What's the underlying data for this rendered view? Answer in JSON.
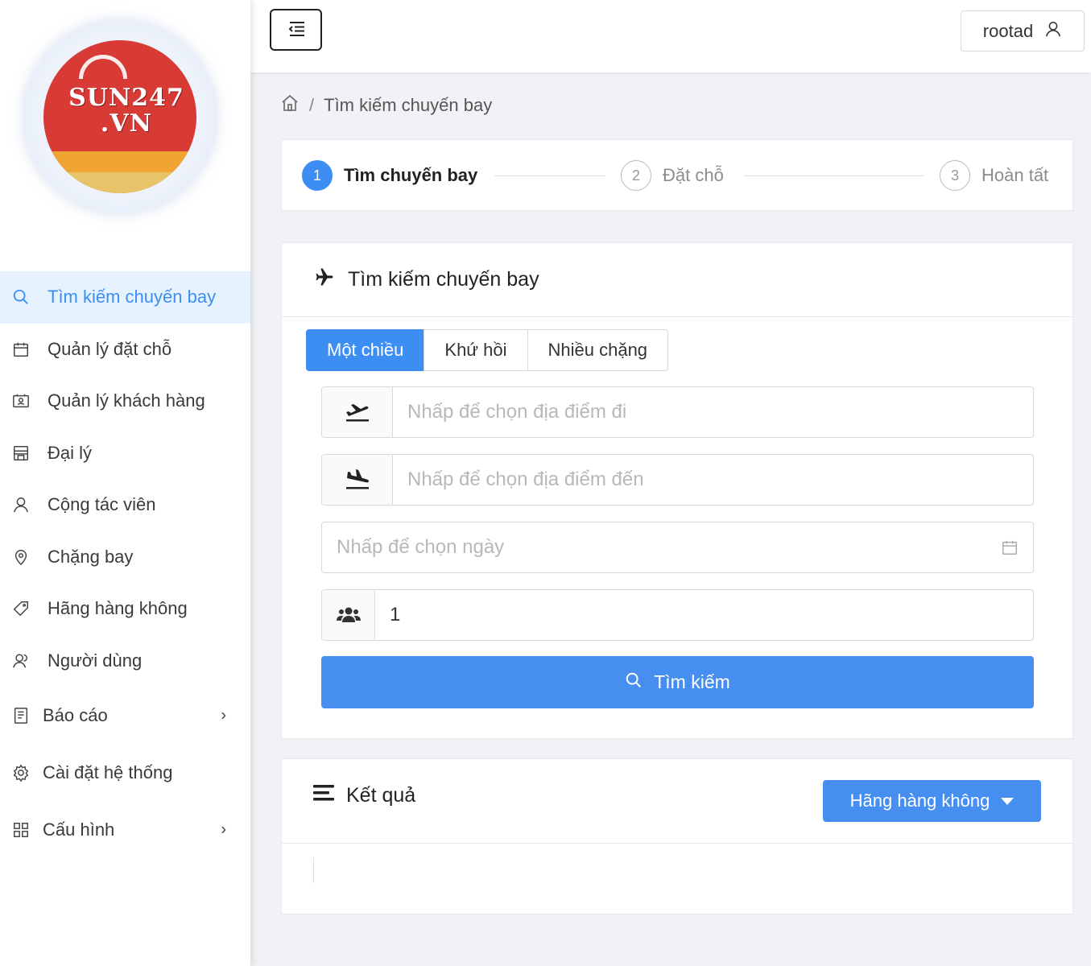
{
  "brand": {
    "logo_text_line1": "SUN247",
    "logo_text_line2": ".VN"
  },
  "header": {
    "username": "rootad"
  },
  "breadcrumb": {
    "current": "Tìm kiếm chuyến bay",
    "separator": "/"
  },
  "sidebar": {
    "items": [
      {
        "label": "Tìm kiếm chuyến bay",
        "icon": "search-icon",
        "active": true
      },
      {
        "label": "Quản lý đặt chỗ",
        "icon": "calendar-icon"
      },
      {
        "label": "Quản lý khách hàng",
        "icon": "contact-card-icon"
      },
      {
        "label": "Đại lý",
        "icon": "shop-icon"
      },
      {
        "label": "Cộng tác viên",
        "icon": "user-icon"
      },
      {
        "label": "Chặng bay",
        "icon": "location-pin-icon"
      },
      {
        "label": "Hãng hàng không",
        "icon": "tag-icon"
      },
      {
        "label": "Người dùng",
        "icon": "users-icon"
      },
      {
        "label": "Báo cáo",
        "icon": "report-icon",
        "has_submenu": true
      },
      {
        "label": "Cài đặt hệ thống",
        "icon": "gear-icon"
      },
      {
        "label": "Cấu hình",
        "icon": "grid-icon",
        "has_submenu": true
      }
    ]
  },
  "steps": [
    {
      "number": "1",
      "label": "Tìm chuyến bay",
      "active": true
    },
    {
      "number": "2",
      "label": "Đặt chỗ"
    },
    {
      "number": "3",
      "label": "Hoàn tất"
    }
  ],
  "search": {
    "title": "Tìm kiếm chuyến bay",
    "tabs": [
      {
        "label": "Một chiều",
        "active": true
      },
      {
        "label": "Khứ hồi"
      },
      {
        "label": "Nhiều chặng"
      }
    ],
    "from_placeholder": "Nhấp để chọn địa điểm đi",
    "to_placeholder": "Nhấp để chọn địa điểm đến",
    "date_placeholder": "Nhấp để chọn ngày",
    "passengers_value": "1",
    "button_label": "Tìm kiếm"
  },
  "results": {
    "title": "Kết quả",
    "airline_dropdown_label": "Hãng hàng không"
  },
  "colors": {
    "primary": "#3d8ef3",
    "button": "#468ff1",
    "active_bg": "#e6f2fd",
    "logo_red": "#d83a36"
  }
}
